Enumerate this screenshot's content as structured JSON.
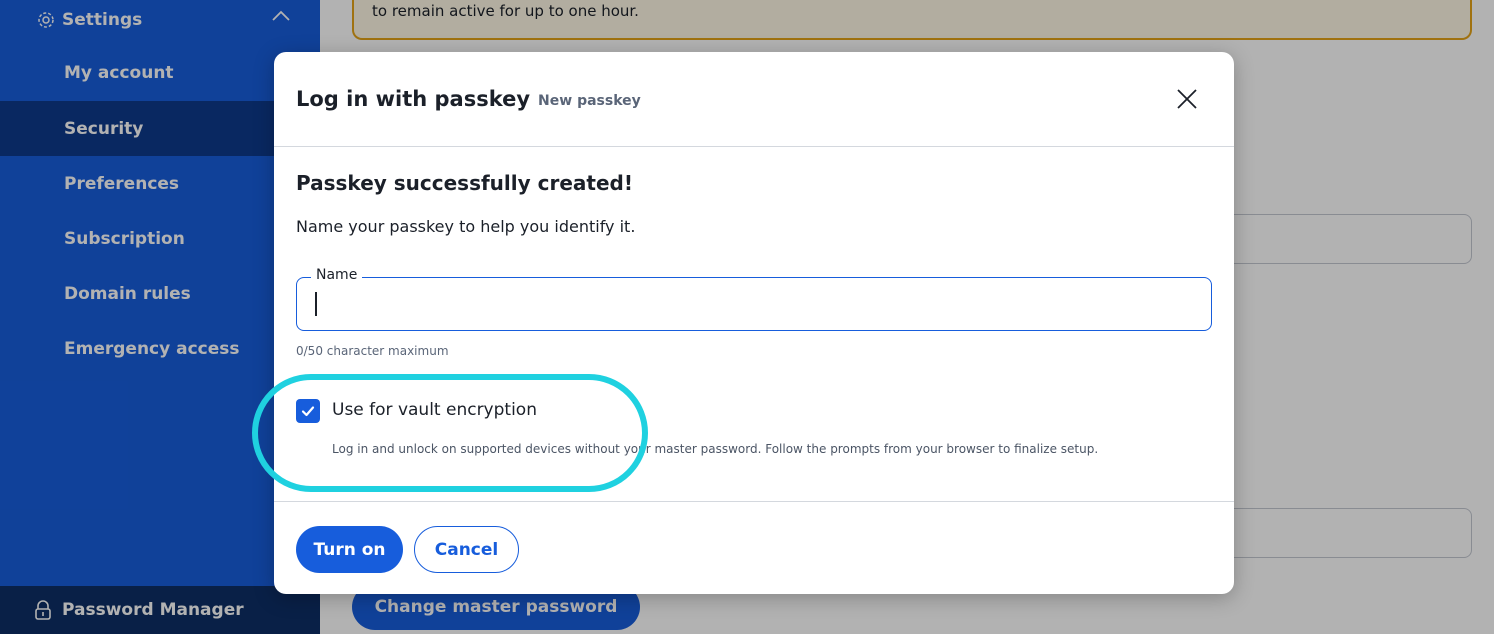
{
  "sidebar": {
    "header": "Settings",
    "items": [
      {
        "label": "My account"
      },
      {
        "label": "Security"
      },
      {
        "label": "Preferences"
      },
      {
        "label": "Subscription"
      },
      {
        "label": "Domain rules"
      },
      {
        "label": "Emergency access"
      }
    ],
    "active_item": "Security",
    "footer": "Password Manager"
  },
  "main": {
    "callout_text": "to remain active for up to one hour.",
    "change_password_button": "Change master password"
  },
  "modal": {
    "title": "Log in with passkey",
    "subtitle": "New passkey",
    "heading": "Passkey successfully created!",
    "description": "Name your passkey to help you identify it.",
    "name_field": {
      "label": "Name",
      "value": "",
      "hint": "0/50 character maximum"
    },
    "checkbox": {
      "label": "Use for vault encryption",
      "checked": true,
      "help": "Log in and unlock on supported devices without your master password. Follow the prompts from your browser to finalize setup."
    },
    "primary_button": "Turn on",
    "secondary_button": "Cancel"
  },
  "colors": {
    "brand": "#175ddc",
    "sidebar_active": "#0d3a8c",
    "highlight_ring": "#1fd1e0",
    "warning_border": "#e6a417"
  },
  "icons": {
    "sidebar_header": "gear-icon",
    "sidebar_collapse": "chevron-up-icon",
    "footer": "lock-icon",
    "modal_close": "close-icon",
    "checkbox": "checkmark-icon"
  }
}
